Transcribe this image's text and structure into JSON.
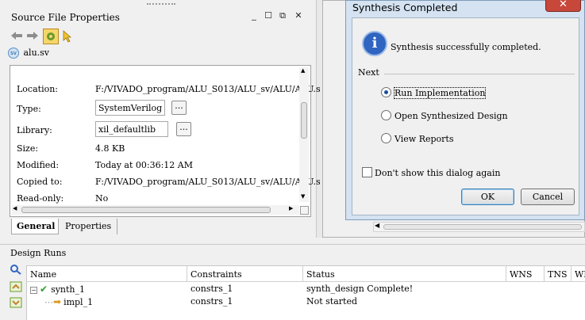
{
  "source_file_properties": {
    "title": "Source File Properties",
    "file_name": "alu.sv",
    "properties": [
      {
        "label": "Location:",
        "value": "F:/VIVADO_program/ALU_S013/ALU_sv/ALU/ALU.s"
      },
      {
        "label": "Type:",
        "value": "SystemVerilog"
      },
      {
        "label": "Library:",
        "value": "xil_defaultlib"
      },
      {
        "label": "Size:",
        "value": "4.8 KB"
      },
      {
        "label": "Modified:",
        "value": "Today at 00:36:12 AM"
      },
      {
        "label": "Copied to:",
        "value": "F:/VIVADO_program/ALU_S013/ALU_sv/ALU/ALU.s"
      },
      {
        "label": "Read-only:",
        "value": "No"
      }
    ],
    "browse_label": "...",
    "tabs": [
      {
        "label": "General"
      },
      {
        "label": "Properties"
      }
    ]
  },
  "dialog": {
    "title": "Synthesis Completed",
    "close_glyph": "✕",
    "message": "Synthesis successfully completed.",
    "next_label": "Next",
    "options": [
      {
        "label": "Run Implementation",
        "selected": true
      },
      {
        "label": "Open Synthesized Design",
        "selected": false
      },
      {
        "label": "View Reports",
        "selected": false
      }
    ],
    "dont_show_label": "Don't show this dialog again",
    "ok_label": "OK",
    "cancel_label": "Cancel"
  },
  "design_runs": {
    "title": "Design Runs",
    "columns": [
      "Name",
      "Constraints",
      "Status",
      "WNS",
      "TNS",
      "WHS"
    ],
    "rows": [
      {
        "name": "synth_1",
        "constraints": "constrs_1",
        "status": "synth_design Complete!"
      },
      {
        "name": "impl_1",
        "constraints": "constrs_1",
        "status": "Not started"
      }
    ]
  },
  "colors": {
    "dialog_frame": "#d4e2f1",
    "close_button": "#c7473b",
    "info_icon": "#2f64c1",
    "check_green": "#2e9c2e",
    "arrow_orange": "#d79a1b"
  },
  "icons": {
    "toolbar": [
      "back-arrow-icon",
      "forward-arrow-icon",
      "settings-icon",
      "pointer-icon"
    ],
    "side": [
      "search-icon",
      "collapse-all-icon",
      "expand-all-icon"
    ]
  }
}
